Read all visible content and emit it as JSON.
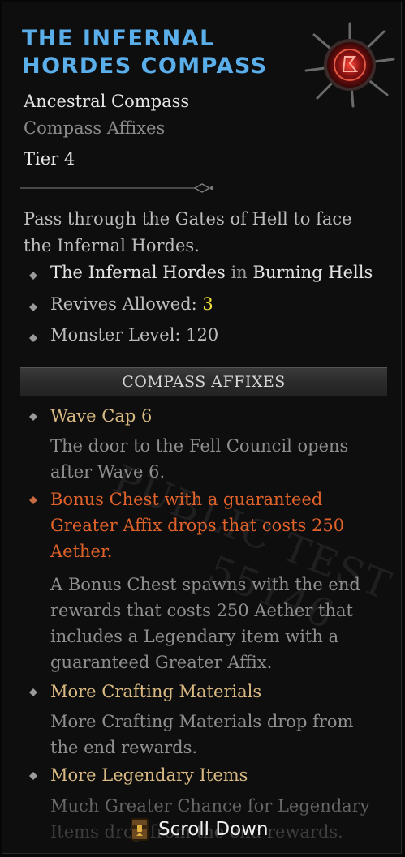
{
  "item": {
    "title_line1": "The Infernal",
    "title_line2": "Hordes Compass",
    "type": "Ancestral Compass",
    "affix_kind": "Compass Affixes",
    "tier": "Tier 4",
    "description_line1": "Pass through the Gates of Hell to face",
    "description_line2": "the Infernal Hordes.",
    "icon": "infernal-compass-icon"
  },
  "properties": {
    "destination": "The Infernal Hordes",
    "destination_connector": "in",
    "region": "Burning Hells",
    "revives_label": "Revives Allowed:",
    "revives_value": "3",
    "monster_level_label": "Monster Level:",
    "monster_level_value": "120"
  },
  "section_header": "Compass Affixes",
  "affixes": [
    {
      "name": "Wave Cap 6",
      "desc_lines": [
        "The door to the Fell Council opens",
        "after Wave 6."
      ]
    },
    {
      "name_lines": [
        "Bonus Chest with a guaranteed",
        "Greater Affix drops that costs 250",
        "Aether."
      ],
      "desc_lines": [
        "A Bonus Chest spawns with the end",
        "rewards that costs 250 Aether that",
        "includes a Legendary item with a",
        "guaranteed Greater Affix."
      ]
    },
    {
      "name": "More Crafting Materials",
      "desc_lines": [
        "More Crafting Materials drop from",
        "the end rewards."
      ]
    },
    {
      "name": "More Legendary Items",
      "desc_lines": [
        "Much Greater Chance for Legendary",
        "Items drop from the end rewards."
      ]
    }
  ],
  "watermark": {
    "line1": "PUBLIC TEST",
    "line2": "55146"
  },
  "scroll_hint": {
    "label": "Scroll Down",
    "icon": "scroll-chest-icon"
  },
  "colors": {
    "title": "#5aaeea",
    "affix_gold": "#d9b982",
    "affix_orange": "#e0622a",
    "revives_yellow": "#f2df3c"
  }
}
